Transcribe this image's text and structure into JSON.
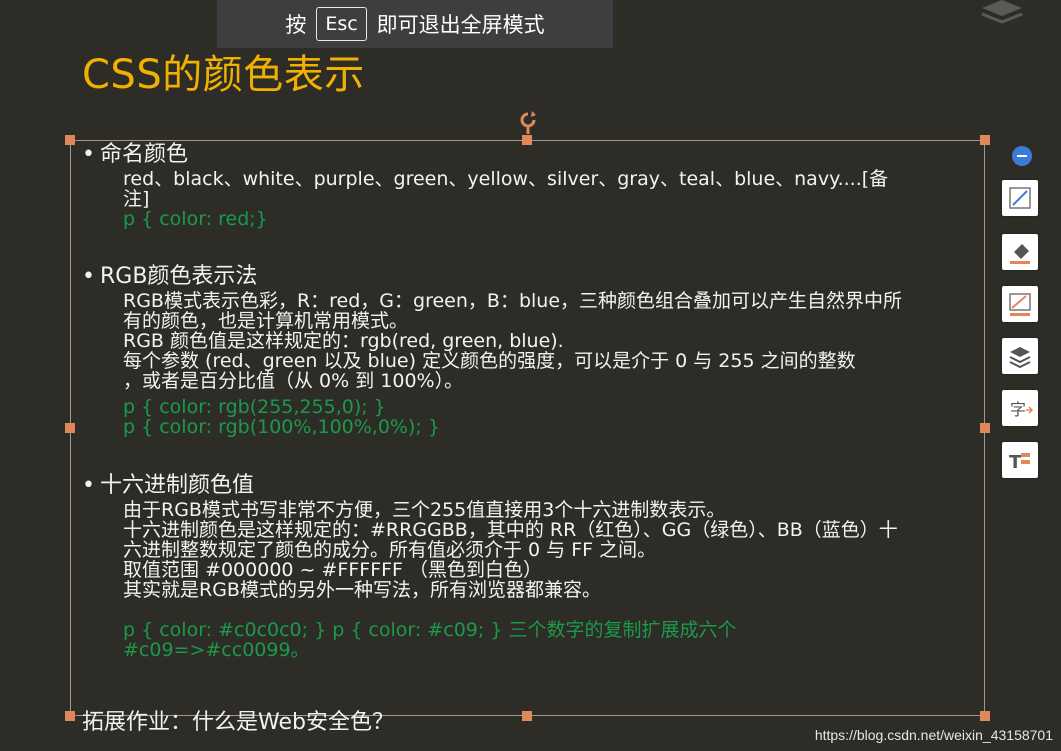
{
  "fullscreen_banner": {
    "prefix": "按",
    "key": "Esc",
    "suffix": "即可退出全屏模式"
  },
  "slide": {
    "title": "CSS的颜色表示",
    "sections": [
      {
        "heading": "命名颜色",
        "lines": [
          {
            "text": "red、black、white、purple、green、yellow、silver、gray、teal、blue、navy....[备",
            "style": "normal"
          },
          {
            "text": "注]",
            "style": "normal"
          },
          {
            "text": "p { color: red;}",
            "style": "code"
          }
        ]
      },
      {
        "heading": "RGB颜色表示法",
        "lines": [
          {
            "text": "RGB模式表示色彩，R：red，G：green，B：blue，三种颜色组合叠加可以产生自然界中所",
            "style": "normal"
          },
          {
            "text": "有的颜色，也是计算机常用模式。",
            "style": "normal"
          },
          {
            "text": "RGB 颜色值是这样规定的：rgb(red, green, blue).",
            "style": "normal"
          },
          {
            "text": "每个参数 (red、green 以及 blue) 定义颜色的强度，可以是介于 0 与 255 之间的整数",
            "style": "normal"
          },
          {
            "text": "，或者是百分比值（从 0% 到 100%）。",
            "style": "normal"
          },
          {
            "text": "p { color: rgb(255,255,0); }",
            "style": "code"
          },
          {
            "text": "p { color: rgb(100%,100%,0%); }",
            "style": "code"
          }
        ]
      },
      {
        "heading": "十六进制颜色值",
        "lines": [
          {
            "text": "由于RGB模式书写非常不方便，三个255值直接用3个十六进制数表示。",
            "style": "normal"
          },
          {
            "text": "十六进制颜色是这样规定的：#RRGGBB，其中的 RR（红色）、GG（绿色）、BB（蓝色）十",
            "style": "normal"
          },
          {
            "text": "六进制整数规定了颜色的成分。所有值必须介于 0 与 FF 之间。",
            "style": "normal"
          },
          {
            "text": "取值范围 #000000 ~ #FFFFFF （黑色到白色）",
            "style": "normal"
          },
          {
            "text": "其实就是RGB模式的另外一种写法，所有浏览器都兼容。",
            "style": "normal"
          },
          {
            "text": "p { color: #c0c0c0; }   p { color: #c09; }    三个数字的复制扩展成六个",
            "style": "code"
          },
          {
            "text": "#c09=>#cc0099。",
            "style": "code"
          }
        ]
      }
    ],
    "extension": "拓展作业：什么是Web安全色？"
  },
  "toolbar": {
    "items": [
      "collapse-icon",
      "edit-shape-icon",
      "fill-icon",
      "outline-icon",
      "layers-icon",
      "text-replace-icon",
      "text-format-icon"
    ]
  },
  "watermark": "https://blog.csdn.net/weixin_43158701",
  "colors": {
    "title": "#f0b100",
    "code": "#1a9a4a",
    "text": "#f2f2f2",
    "background": "#2d2c26",
    "handle": "#e0885a"
  }
}
